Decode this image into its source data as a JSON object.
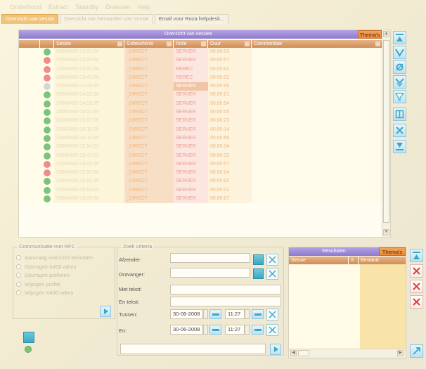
{
  "menu": {
    "items": [
      "",
      "Onderhoud",
      "Extract",
      "Standby",
      "Diversen",
      "Help"
    ]
  },
  "tabs": [
    {
      "label": "Overzicht van sessie"
    },
    {
      "label": "Overzicht van bestanden van sessie"
    },
    {
      "label": "Email voor Roza helpdesk..."
    }
  ],
  "sessions_panel": {
    "title": "Overzicht van sessies",
    "themas_label": "Thema's",
    "columns": [
      "",
      "Sessie",
      "Gebeurtenis",
      "Actie",
      "Duur",
      "Commentaar"
    ],
    "rows": [
      {
        "status": "green",
        "sessie": "20060405-13:31:50",
        "gebeurtenis": "_DIRECT",
        "actie": "SERVER",
        "duur": "00:00:03",
        "commentaar": ""
      },
      {
        "status": "red",
        "sessie": "20060405-13:39:54",
        "gebeurtenis": "_DIRECT",
        "actie": "SERVER",
        "duur": "00:00:07",
        "commentaar": ""
      },
      {
        "status": "red",
        "sessie": "20060405-13:41:56",
        "gebeurtenis": "_DIRECT",
        "actie": "REREC",
        "duur": "00:00:02",
        "commentaar": ""
      },
      {
        "status": "red",
        "sessie": "20060405-13:43:26",
        "gebeurtenis": "_DIRECT",
        "actie": "REREC",
        "duur": "00:00:02",
        "commentaar": ""
      },
      {
        "status": "gray",
        "sessie": "20060405-14:43:40",
        "gebeurtenis": "_DIRECT",
        "actie": "SERVER",
        "duur": "00:00:00",
        "commentaar": "",
        "highlight": true
      },
      {
        "status": "green",
        "sessie": "20060405-14:52:39",
        "gebeurtenis": "_DIRECT",
        "actie": "SERVER",
        "duur": "00:00:01",
        "commentaar": ""
      },
      {
        "status": "green",
        "sessie": "20060405-14:59:25",
        "gebeurtenis": "_DIRECT",
        "actie": "SERVER",
        "duur": "00:00:54",
        "commentaar": ""
      },
      {
        "status": "green",
        "sessie": "20060405-15:01:49",
        "gebeurtenis": "_DIRECT",
        "actie": "SERVER",
        "duur": "00:00:05",
        "commentaar": ""
      },
      {
        "status": "green",
        "sessie": "20060405-15:07:55",
        "gebeurtenis": "_DIRECT",
        "actie": "SERVER",
        "duur": "00:00:23",
        "commentaar": ""
      },
      {
        "status": "green",
        "sessie": "20060405-15:10:25",
        "gebeurtenis": "_DIRECT",
        "actie": "SERVER",
        "duur": "00:00:14",
        "commentaar": ""
      },
      {
        "status": "green",
        "sessie": "20060405-15:11:54",
        "gebeurtenis": "_DIRECT",
        "actie": "SERVER",
        "duur": "00:00:56",
        "commentaar": ""
      },
      {
        "status": "green",
        "sessie": "20060405-15:34:57",
        "gebeurtenis": "_DIRECT",
        "actie": "SERVER",
        "duur": "00:00:34",
        "commentaar": ""
      },
      {
        "status": "green",
        "sessie": "20060405-15:42:01",
        "gebeurtenis": "_DIRECT",
        "actie": "SERVER",
        "duur": "00:00:23",
        "commentaar": ""
      },
      {
        "status": "red",
        "sessie": "20060405-15:43:30",
        "gebeurtenis": "_DIRECT",
        "actie": "SERVER",
        "duur": "00:00:07",
        "commentaar": ""
      },
      {
        "status": "red",
        "sessie": "20060405-15:50:59",
        "gebeurtenis": "_DIRECT",
        "actie": "SERVER",
        "duur": "00:00:04",
        "commentaar": ""
      },
      {
        "status": "green",
        "sessie": "20060405-15:52:39",
        "gebeurtenis": "_DIRECT",
        "actie": "SERVER",
        "duur": "00:00:02",
        "commentaar": ""
      },
      {
        "status": "green",
        "sessie": "20060405-15:54:01",
        "gebeurtenis": "_DIRECT",
        "actie": "SERVER",
        "duur": "00:00:02",
        "commentaar": ""
      },
      {
        "status": "green",
        "sessie": "20060405-16:39:55",
        "gebeurtenis": "_DIRECT",
        "actie": "SERVER",
        "duur": "00:00:07",
        "commentaar": ""
      }
    ]
  },
  "status_colors": {
    "green": "#7cc47a",
    "red": "#f08c8c",
    "gray": "#d6d6d6"
  },
  "side_toolbar": {
    "icons": [
      "go-top-icon",
      "filter-icon",
      "refresh-filter-icon",
      "filter-down-icon",
      "clear-filter-icon",
      "columns-icon",
      "delete-icon",
      "go-bottom-icon"
    ]
  },
  "rfc_group": {
    "title": "Communicatie met RFC",
    "options": [
      "Aanvraag overzicht berichten",
      "Opvragen X400 adres",
      "Opvragen profielen",
      "Wijzigen profiel",
      "Wijzigen X400-adres"
    ]
  },
  "search": {
    "title": "Zoek criteria",
    "afzender_label": "Afzender:",
    "afzender_value": "",
    "ontvanger_label": "Ontvanger:",
    "ontvanger_value": "",
    "met_tekst_label": "Met tekst:",
    "met_tekst_value": "",
    "en_tekst_label": "En tekst:",
    "en_tekst_value": "",
    "tussen_label": "Tussen:",
    "tussen_date": "30-06-2008",
    "tussen_time": "11:27",
    "en_label": "En:",
    "en_date": "30-06-2008",
    "en_time": "11:27",
    "footer_value": ""
  },
  "results": {
    "title": "Resultaten",
    "themas_label": "Thema's",
    "columns": [
      "Sessie",
      "X",
      "Bestand"
    ]
  }
}
